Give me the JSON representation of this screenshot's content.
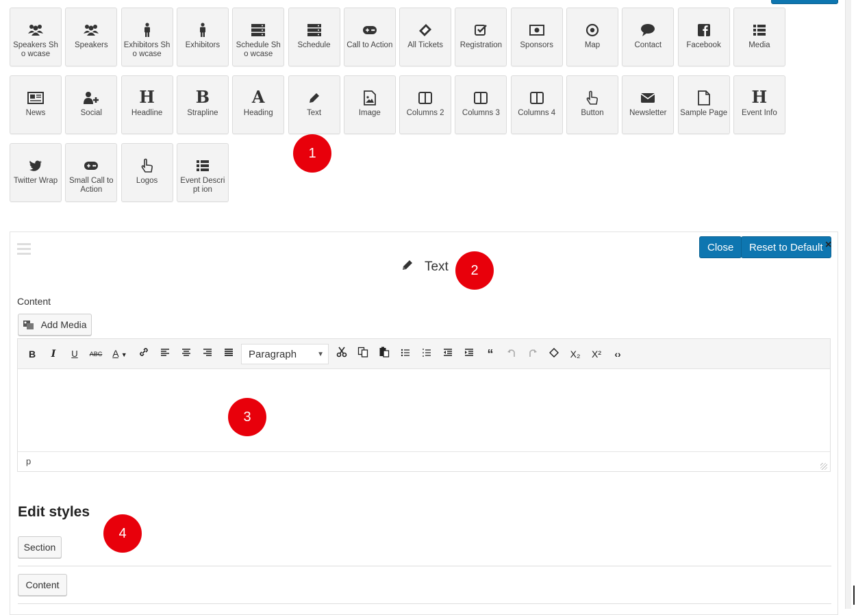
{
  "blocks": {
    "row1": [
      {
        "label": "Speakers Sho wcase",
        "icon": "users-icon"
      },
      {
        "label": "Speakers",
        "icon": "users-icon"
      },
      {
        "label": "Exhibitors Sho wcase",
        "icon": "person-icon"
      },
      {
        "label": "Exhibitors",
        "icon": "person-icon"
      },
      {
        "label": "Schedule Sho wcase",
        "icon": "server-icon"
      },
      {
        "label": "Schedule",
        "icon": "server-icon"
      },
      {
        "label": "Call to Action",
        "icon": "gamepad-icon"
      },
      {
        "label": "All Tickets",
        "icon": "ticket-icon"
      },
      {
        "label": "Registration",
        "icon": "check-square-icon"
      },
      {
        "label": "Sponsors",
        "icon": "money-icon"
      },
      {
        "label": "Map",
        "icon": "target-icon"
      },
      {
        "label": "Contact",
        "icon": "comment-icon"
      },
      {
        "label": "Facebook",
        "icon": "facebook-icon"
      },
      {
        "label": "Media",
        "icon": "list-icon"
      }
    ],
    "row2": [
      {
        "label": "News",
        "icon": "newspaper-icon"
      },
      {
        "label": "Social",
        "icon": "user-plus-icon"
      },
      {
        "label": "Headline",
        "icon": "heading-h-icon",
        "glyph": "H"
      },
      {
        "label": "Strapline",
        "icon": "bold-b-icon",
        "glyph": "B"
      },
      {
        "label": "Heading",
        "icon": "font-a-icon",
        "glyph": "A"
      },
      {
        "label": "Text",
        "icon": "pencil-icon"
      },
      {
        "label": "Image",
        "icon": "image-file-icon"
      },
      {
        "label": "Columns 2",
        "icon": "columns-icon"
      },
      {
        "label": "Columns 3",
        "icon": "columns-icon"
      },
      {
        "label": "Columns 4",
        "icon": "columns-icon"
      },
      {
        "label": "Button",
        "icon": "hand-pointer-icon"
      },
      {
        "label": "Newsletter",
        "icon": "envelope-icon"
      },
      {
        "label": "Sample Page",
        "icon": "file-icon"
      },
      {
        "label": "Event Info",
        "icon": "heading-h-icon",
        "glyph": "H"
      }
    ],
    "row3": [
      {
        "label": "Twitter Wrap",
        "icon": "twitter-icon"
      },
      {
        "label": "Small Call to Action",
        "icon": "gamepad-icon"
      },
      {
        "label": "Logos",
        "icon": "hand-pointer-icon"
      },
      {
        "label": "Event Descript ion",
        "icon": "list-icon"
      }
    ]
  },
  "badges": [
    "1",
    "2",
    "3",
    "4"
  ],
  "panel": {
    "title": "Text",
    "close_label": "Close",
    "reset_label": "Reset to Default",
    "close_icon": "×",
    "content_label": "Content",
    "add_media_label": "Add Media",
    "format_select_value": "Paragraph",
    "status_path": "p",
    "edit_styles_heading": "Edit styles",
    "section_button": "Section",
    "content_button": "Content"
  },
  "toolbar": {
    "bold": "B",
    "italic": "I",
    "underline": "U",
    "strikethrough": "ABC",
    "text_color": "A",
    "subscript": "X₂",
    "superscript": "X²"
  },
  "colors": {
    "primary_button": "#0e76b0",
    "badge": "#e8000b",
    "tile_bg": "#f3f3f3"
  }
}
